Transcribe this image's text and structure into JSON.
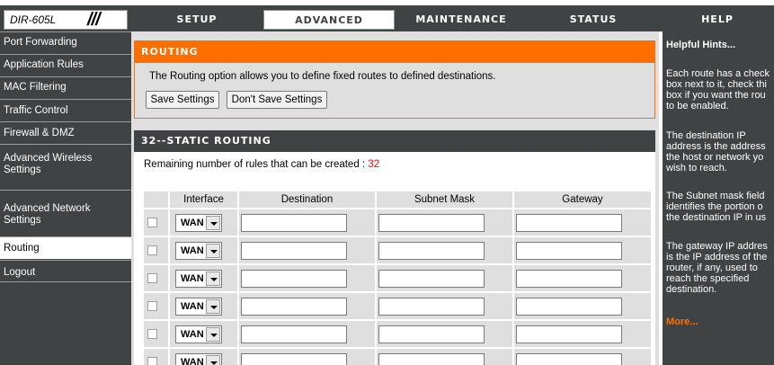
{
  "header": {
    "model": "DIR-605L",
    "tabs": [
      {
        "label": "SETUP",
        "active": false
      },
      {
        "label": "ADVANCED",
        "active": true
      },
      {
        "label": "MAINTENANCE",
        "active": false
      },
      {
        "label": "STATUS",
        "active": false
      },
      {
        "label": "HELP",
        "active": false
      }
    ]
  },
  "sidebar": {
    "items": [
      {
        "label": "Port Forwarding",
        "selected": false
      },
      {
        "label": "Application Rules",
        "selected": false
      },
      {
        "label": "MAC Filtering",
        "selected": false
      },
      {
        "label": "Traffic Control",
        "selected": false
      },
      {
        "label": "Firewall & DMZ",
        "selected": false
      },
      {
        "label_lines": [
          "Advanced Wireless",
          "Settings"
        ],
        "selected": false
      },
      {
        "label_lines": [
          "Advanced Network",
          "Settings"
        ],
        "selected": false
      },
      {
        "label": "Routing",
        "selected": true
      },
      {
        "label": "Logout",
        "selected": false
      }
    ]
  },
  "routing": {
    "title": "ROUTING",
    "description": "The Routing option allows you to define fixed routes to defined destinations.",
    "save_label": "Save Settings",
    "dont_save_label": "Don't Save Settings"
  },
  "static_routing": {
    "title": "32--STATIC ROUTING",
    "remaining_label": "Remaining number of rules that can be created : ",
    "remaining_count": "32",
    "columns": [
      "Interface",
      "Destination",
      "Subnet Mask",
      "Gateway"
    ],
    "rows": [
      {
        "checked": false,
        "interface": "WAN",
        "destination": "",
        "subnet_mask": "",
        "gateway": ""
      },
      {
        "checked": false,
        "interface": "WAN",
        "destination": "",
        "subnet_mask": "",
        "gateway": ""
      },
      {
        "checked": false,
        "interface": "WAN",
        "destination": "",
        "subnet_mask": "",
        "gateway": ""
      },
      {
        "checked": false,
        "interface": "WAN",
        "destination": "",
        "subnet_mask": "",
        "gateway": ""
      },
      {
        "checked": false,
        "interface": "WAN",
        "destination": "",
        "subnet_mask": "",
        "gateway": ""
      },
      {
        "checked": false,
        "interface": "WAN",
        "destination": "",
        "subnet_mask": "",
        "gateway": ""
      }
    ]
  },
  "hints": {
    "title": "Helpful Hints...",
    "paragraphs": [
      [
        "Each route has a check",
        "box next to it, check thi",
        "box if you want the rou",
        "to be enabled."
      ],
      [
        "The destination IP",
        "address is the address",
        "the host or network yo",
        "wish to reach."
      ],
      [
        "The Subnet mask field",
        "identifies the portion o",
        "the destination IP in us"
      ],
      [
        "The gateway IP addres",
        "is the IP address of the",
        "router, if any, used to",
        "reach the specified",
        "destination."
      ]
    ],
    "more": "More..."
  },
  "colors": {
    "dark": "#404343",
    "accent": "#ff6f00",
    "panel": "#dfdfdf",
    "count": "#ff0000"
  }
}
